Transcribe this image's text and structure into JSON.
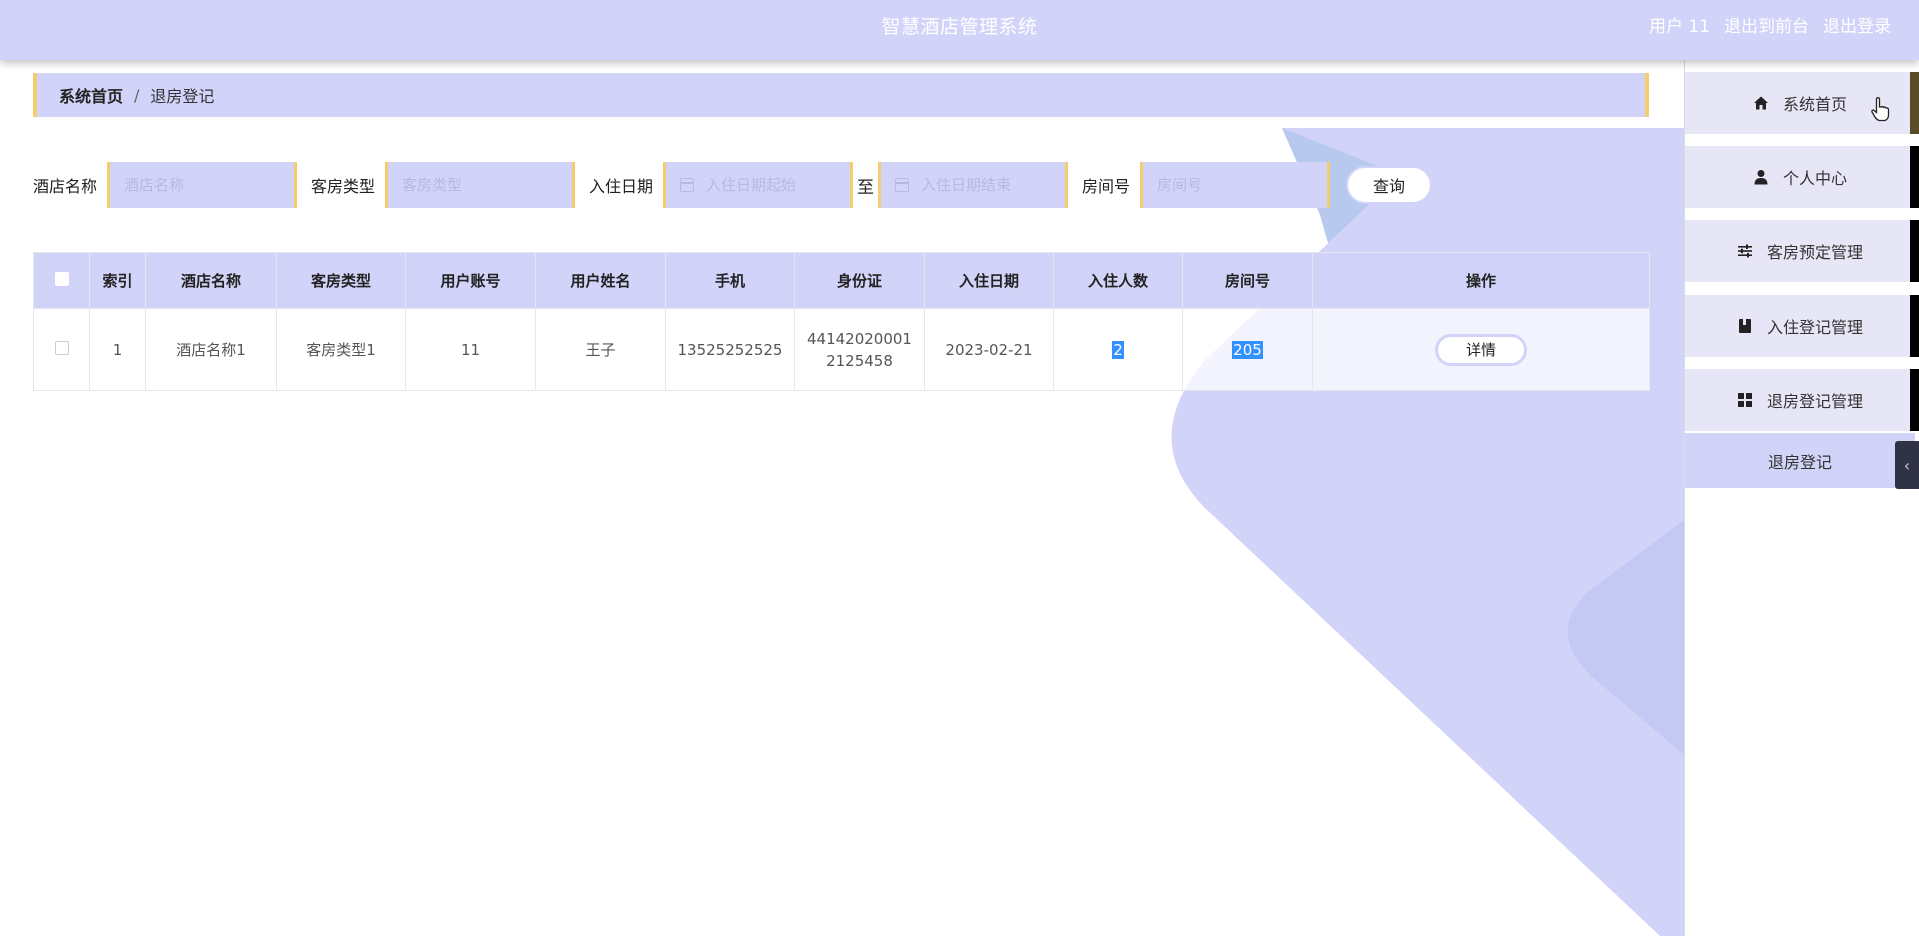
{
  "header": {
    "title": "智慧酒店管理系统",
    "user_label": "用户 11",
    "front_link": "退出到前台",
    "logout_link": "退出登录"
  },
  "breadcrumb": {
    "home": "系统首页",
    "separator": "/",
    "current": "退房登记"
  },
  "search": {
    "hotel_label": "酒店名称",
    "hotel_placeholder": "酒店名称",
    "room_type_label": "客房类型",
    "room_type_placeholder": "客房类型",
    "checkin_label": "入住日期",
    "date_start_placeholder": "入住日期起始",
    "to_label": "至",
    "date_end_placeholder": "入住日期结束",
    "room_no_label": "房间号",
    "room_no_placeholder": "房间号",
    "query_button": "查询"
  },
  "table": {
    "columns": [
      "索引",
      "酒店名称",
      "客房类型",
      "用户账号",
      "用户姓名",
      "手机",
      "身份证",
      "入住日期",
      "入住人数",
      "房间号",
      "操作"
    ],
    "rows": [
      {
        "index": "1",
        "hotel": "酒店名称1",
        "room_type": "客房类型1",
        "account": "11",
        "name": "王子",
        "phone": "13525252525",
        "id_card_line1": "44142020001",
        "id_card_line2": "2125458",
        "checkin_date": "2023-02-21",
        "guests": "2",
        "room_no": "205",
        "action": "详情"
      }
    ]
  },
  "sidebar": {
    "items": [
      {
        "label": "系统首页",
        "icon": "home-icon"
      },
      {
        "label": "个人中心",
        "icon": "user-icon"
      },
      {
        "label": "客房预定管理",
        "icon": "sliders-icon"
      },
      {
        "label": "入住登记管理",
        "icon": "book-icon"
      },
      {
        "label": "退房登记管理",
        "icon": "grid-icon"
      }
    ],
    "sub_item": "退房登记"
  },
  "colors": {
    "accent": "#d2d3f9",
    "border_accent": "#f6cd6c",
    "selection": "#3390ff"
  }
}
